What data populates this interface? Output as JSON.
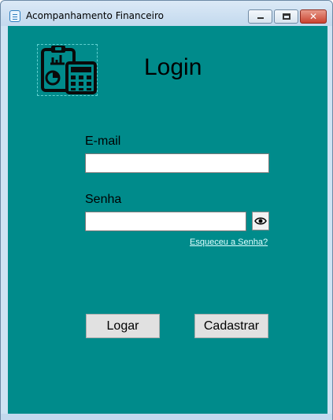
{
  "window": {
    "title": "Acompanhamento Financeiro",
    "close_glyph": "✕",
    "app_icon": "app-document-icon"
  },
  "colors": {
    "background": "#008b8b",
    "titlebar": "#c3d9ee",
    "link": "#e0ffff",
    "button": "#e1e1e1"
  },
  "login": {
    "title": "Login",
    "logo_icon": "finance-clipboard-calculator-icon",
    "email_label": "E-mail",
    "email_value": "",
    "password_label": "Senha",
    "password_value": "",
    "show_password_icon": "eye-icon",
    "forgot_password": "Esqueceu a Senha?",
    "login_button": "Logar",
    "register_button": "Cadastrar"
  }
}
